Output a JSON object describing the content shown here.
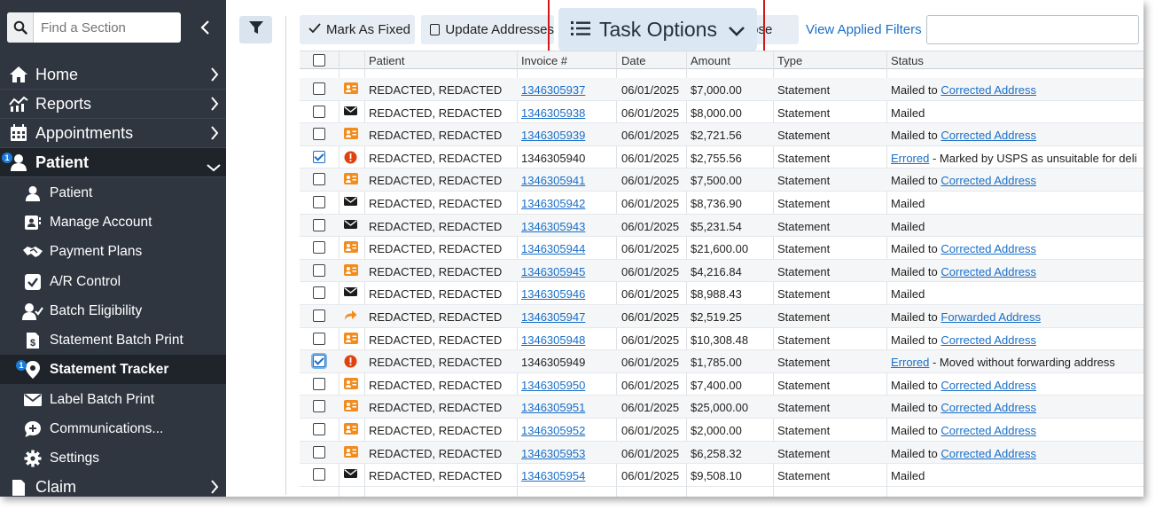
{
  "sidebar": {
    "search_placeholder": "Find a Section",
    "items": [
      {
        "label": "Home"
      },
      {
        "label": "Reports"
      },
      {
        "label": "Appointments"
      },
      {
        "label": "Patient",
        "badge": "1"
      },
      {
        "label": "Patient"
      },
      {
        "label": "Manage Account"
      },
      {
        "label": "Payment Plans"
      },
      {
        "label": "A/R Control"
      },
      {
        "label": "Batch Eligibility"
      },
      {
        "label": "Statement Batch Print"
      },
      {
        "label": "Statement Tracker",
        "badge": "1"
      },
      {
        "label": "Label Batch Print"
      },
      {
        "label": "Communications..."
      },
      {
        "label": "Settings"
      },
      {
        "label": "Claim"
      }
    ]
  },
  "toolbar": {
    "mark_fixed": "Mark As Fixed",
    "update_addresses": "Update Addresses",
    "task_options": "Task Options",
    "close": "Close",
    "view_filters": "View Applied Filters"
  },
  "table": {
    "columns": [
      "Patient",
      "Invoice #",
      "Date",
      "Amount",
      "Type",
      "Status"
    ],
    "rows": [
      {
        "icon": "address",
        "checked": false,
        "patient": "REDACTED, REDACTED",
        "invoice": "1346305937",
        "date": "06/01/2025",
        "amount": "$7,000.00",
        "type": "Statement",
        "status": "Mailed to ",
        "status_link": "Corrected Address",
        "status_after": ""
      },
      {
        "icon": "mail",
        "checked": false,
        "patient": "REDACTED, REDACTED",
        "invoice": "1346305938",
        "date": "06/01/2025",
        "amount": "$8,000.00",
        "type": "Statement",
        "status": "Mailed",
        "status_link": "",
        "status_after": ""
      },
      {
        "icon": "address",
        "checked": false,
        "patient": "REDACTED, REDACTED",
        "invoice": "1346305939",
        "date": "06/01/2025",
        "amount": "$2,721.56",
        "type": "Statement",
        "status": "Mailed to ",
        "status_link": "Corrected Address",
        "status_after": ""
      },
      {
        "icon": "error",
        "checked": true,
        "patient": "REDACTED, REDACTED",
        "invoice": "1346305940",
        "date": "06/01/2025",
        "amount": "$2,755.56",
        "type": "Statement",
        "status": "",
        "status_link": "Errored",
        "status_after": " - Marked by USPS as unsuitable for deli"
      },
      {
        "icon": "address",
        "checked": false,
        "patient": "REDACTED, REDACTED",
        "invoice": "1346305941",
        "date": "06/01/2025",
        "amount": "$7,500.00",
        "type": "Statement",
        "status": "Mailed to ",
        "status_link": "Corrected Address",
        "status_after": ""
      },
      {
        "icon": "mail",
        "checked": false,
        "patient": "REDACTED, REDACTED",
        "invoice": "1346305942",
        "date": "06/01/2025",
        "amount": "$8,736.90",
        "type": "Statement",
        "status": "Mailed",
        "status_link": "",
        "status_after": ""
      },
      {
        "icon": "mail",
        "checked": false,
        "patient": "REDACTED, REDACTED",
        "invoice": "1346305943",
        "date": "06/01/2025",
        "amount": "$5,231.54",
        "type": "Statement",
        "status": "Mailed",
        "status_link": "",
        "status_after": ""
      },
      {
        "icon": "address",
        "checked": false,
        "patient": "REDACTED, REDACTED",
        "invoice": "1346305944",
        "date": "06/01/2025",
        "amount": "$21,600.00",
        "type": "Statement",
        "status": "Mailed to ",
        "status_link": "Corrected Address",
        "status_after": ""
      },
      {
        "icon": "address",
        "checked": false,
        "patient": "REDACTED, REDACTED",
        "invoice": "1346305945",
        "date": "06/01/2025",
        "amount": "$4,216.84",
        "type": "Statement",
        "status": "Mailed to ",
        "status_link": "Corrected Address",
        "status_after": ""
      },
      {
        "icon": "mail",
        "checked": false,
        "patient": "REDACTED, REDACTED",
        "invoice": "1346305946",
        "date": "06/01/2025",
        "amount": "$8,988.43",
        "type": "Statement",
        "status": "Mailed",
        "status_link": "",
        "status_after": ""
      },
      {
        "icon": "forward",
        "checked": false,
        "patient": "REDACTED, REDACTED",
        "invoice": "1346305947",
        "date": "06/01/2025",
        "amount": "$2,519.25",
        "type": "Statement",
        "status": "Mailed to ",
        "status_link": "Forwarded Address",
        "status_after": ""
      },
      {
        "icon": "address",
        "checked": false,
        "patient": "REDACTED, REDACTED",
        "invoice": "1346305948",
        "date": "06/01/2025",
        "amount": "$10,308.48",
        "type": "Statement",
        "status": "Mailed to ",
        "status_link": "Corrected Address",
        "status_after": ""
      },
      {
        "icon": "error",
        "checked": true,
        "patient": "REDACTED, REDACTED",
        "invoice": "1346305949",
        "date": "06/01/2025",
        "amount": "$1,785.00",
        "type": "Statement",
        "status": "",
        "status_link": "Errored",
        "status_after": " - Moved without forwarding address"
      },
      {
        "icon": "address",
        "checked": false,
        "patient": "REDACTED, REDACTED",
        "invoice": "1346305950",
        "date": "06/01/2025",
        "amount": "$7,400.00",
        "type": "Statement",
        "status": "Mailed to ",
        "status_link": "Corrected Address",
        "status_after": ""
      },
      {
        "icon": "address",
        "checked": false,
        "patient": "REDACTED, REDACTED",
        "invoice": "1346305951",
        "date": "06/01/2025",
        "amount": "$25,000.00",
        "type": "Statement",
        "status": "Mailed to ",
        "status_link": "Corrected Address",
        "status_after": ""
      },
      {
        "icon": "address",
        "checked": false,
        "patient": "REDACTED, REDACTED",
        "invoice": "1346305952",
        "date": "06/01/2025",
        "amount": "$2,000.00",
        "type": "Statement",
        "status": "Mailed to ",
        "status_link": "Corrected Address",
        "status_after": ""
      },
      {
        "icon": "address",
        "checked": false,
        "patient": "REDACTED, REDACTED",
        "invoice": "1346305953",
        "date": "06/01/2025",
        "amount": "$6,258.32",
        "type": "Statement",
        "status": "Mailed to ",
        "status_link": "Corrected Address",
        "status_after": ""
      },
      {
        "icon": "mail",
        "checked": false,
        "patient": "REDACTED, REDACTED",
        "invoice": "1346305954",
        "date": "06/01/2025",
        "amount": "$9,508.10",
        "type": "Statement",
        "status": "Mailed",
        "status_link": "",
        "status_after": ""
      }
    ]
  },
  "colors": {
    "link": "#1a6fc7",
    "sidebar": "#2f3640",
    "address_icon": "#f28c1e",
    "error_icon": "#e0420f",
    "highlight": "#d01818"
  }
}
